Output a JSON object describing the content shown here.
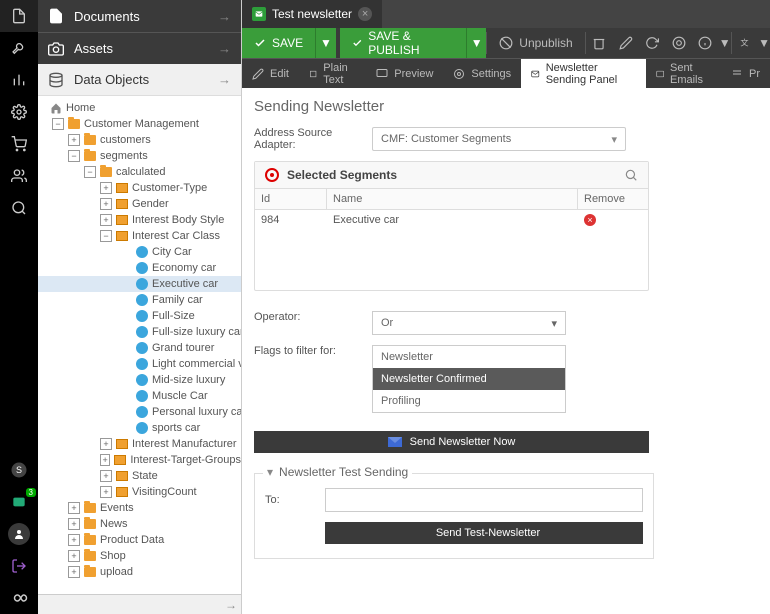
{
  "nav": {
    "documents": "Documents",
    "assets": "Assets",
    "dataObjects": "Data Objects"
  },
  "badge3": "3",
  "tree": {
    "home": "Home",
    "cm": "Customer Management",
    "customers": "customers",
    "segments": "segments",
    "calculated": "calculated",
    "custType": "Customer-Type",
    "gender": "Gender",
    "bodyStyle": "Interest Body Style",
    "carClass": "Interest Car Class",
    "city": "City Car",
    "economy": "Economy car",
    "executive": "Executive car",
    "family": "Family car",
    "fullSize": "Full-Size",
    "fullLux": "Full-size luxury car",
    "grand": "Grand tourer",
    "lightComm": "Light commercial v",
    "midLux": "Mid-size luxury",
    "muscle": "Muscle Car",
    "persLux": "Personal luxury car",
    "sports": "sports car",
    "manuf": "Interest Manufacturer",
    "targetGroups": "Interest-Target-Groups",
    "state": "State",
    "visiting": "VisitingCount",
    "events": "Events",
    "news": "News",
    "productData": "Product Data",
    "shop": "Shop",
    "upload": "upload"
  },
  "tab": {
    "title": "Test newsletter"
  },
  "toolbar": {
    "save": "SAVE",
    "savePublish": "SAVE & PUBLISH",
    "unpublish": "Unpublish"
  },
  "subbar": {
    "edit": "Edit",
    "plainText": "Plain Text",
    "preview": "Preview",
    "settings": "Settings",
    "nsp": "Newsletter Sending Panel",
    "sentEmails": "Sent Emails",
    "prop": "Pr"
  },
  "page": {
    "title": "Sending Newsletter",
    "adapterLabel": "Address Source Adapter:",
    "adapterValue": "CMF: Customer Segments",
    "segPanel": "Selected Segments",
    "colId": "Id",
    "colName": "Name",
    "colRemove": "Remove",
    "rowId": "984",
    "rowName": "Executive car",
    "operatorLabel": "Operator:",
    "operatorValue": "Or",
    "flagsLabel": "Flags to filter for:",
    "opt1": "Newsletter",
    "opt2": "Newsletter Confirmed",
    "opt3": "Profiling",
    "sendNow": "Send Newsletter Now",
    "testSending": "Newsletter Test Sending",
    "to": "To:",
    "sendTest": "Send Test-Newsletter"
  }
}
